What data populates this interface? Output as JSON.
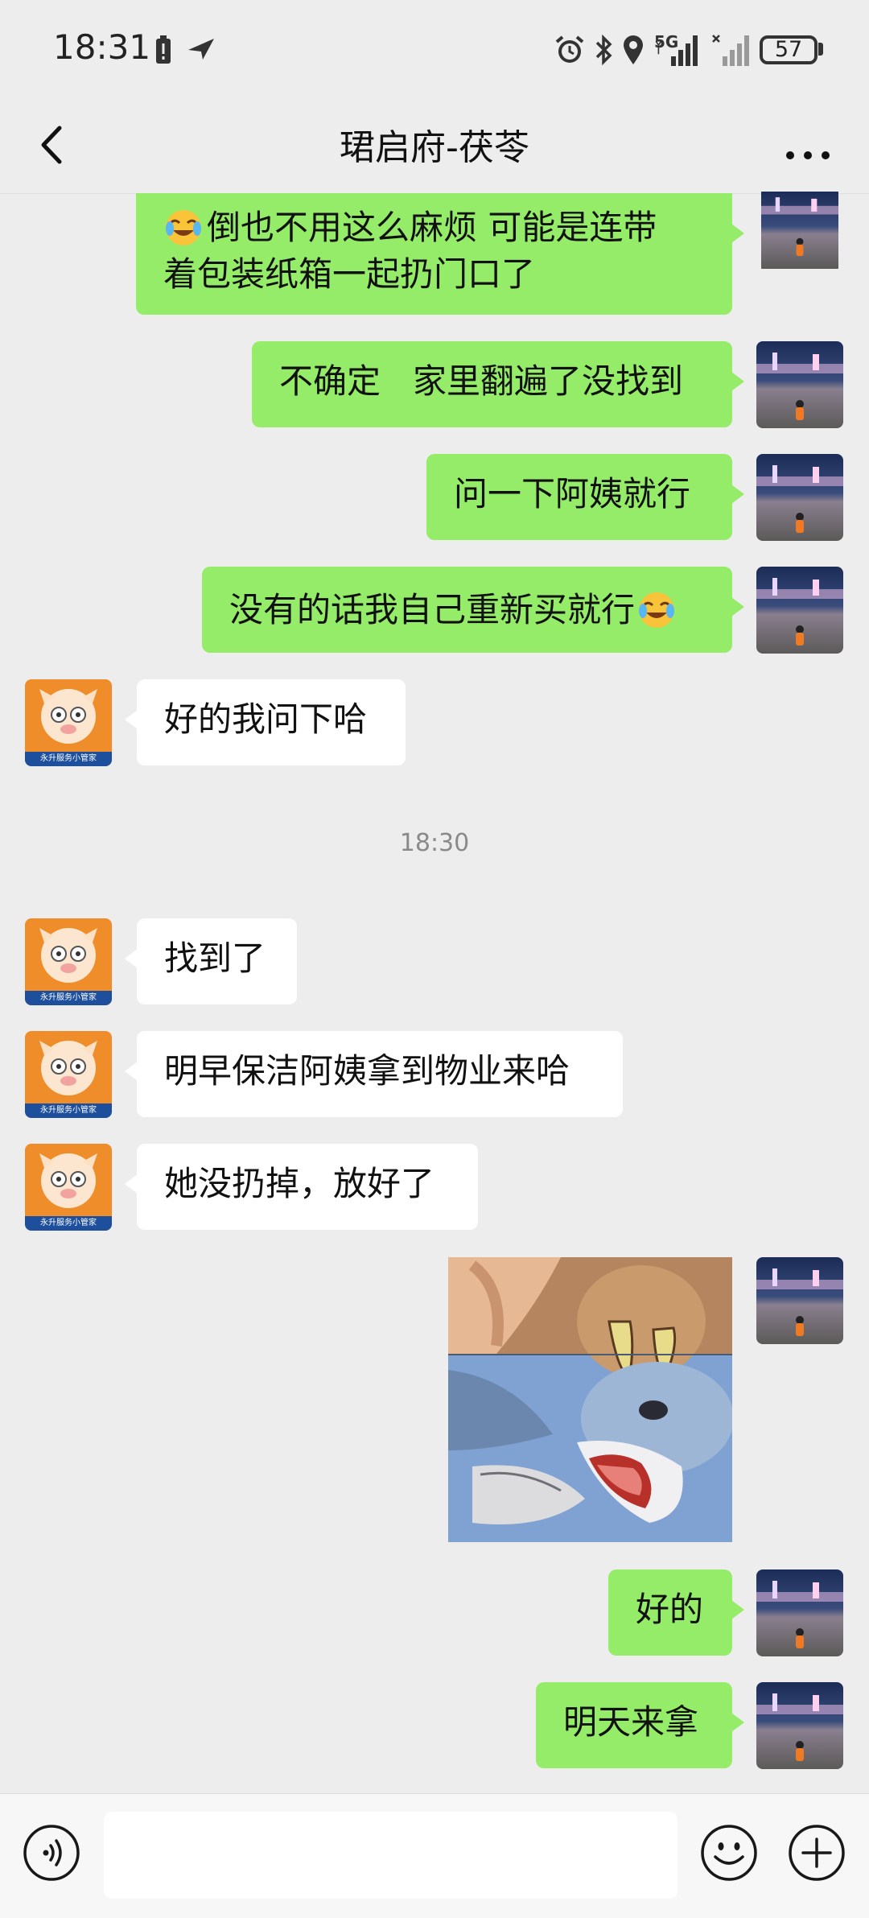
{
  "status_bar": {
    "time": "18:31",
    "network": "5G",
    "battery": "57"
  },
  "header": {
    "title": "珺启府-茯苓",
    "back_icon": "chevron-left-icon",
    "more_icon": "more-horizontal-icon"
  },
  "messages": [
    {
      "side": "right",
      "lines": [
        "倒也不用这么麻烦  可能是连带",
        "着包装纸箱一起扔门口了"
      ],
      "emoji": "face-with-tears-of-joy"
    },
    {
      "side": "right",
      "text": "不确定   家里翻遍了没找到"
    },
    {
      "side": "right",
      "text": "问一下阿姨就行"
    },
    {
      "side": "right",
      "text": "没有的话我自己重新买就行",
      "emoji": "face-with-tears-of-joy"
    },
    {
      "side": "left",
      "text": "好的我问下哈"
    },
    {
      "side": "right",
      "text": "好的"
    },
    {
      "side": "right",
      "text": "明天来拿"
    }
  ],
  "timestamp": "18:30",
  "messages_after": [
    {
      "side": "left",
      "text": "找到了"
    },
    {
      "side": "left",
      "text": "明早保洁阿姨拿到物业来哈"
    },
    {
      "side": "left",
      "text": "她没扔掉，放好了"
    }
  ],
  "avatar_label": "永升服务小管家",
  "bottom_bar": {
    "input_value": "",
    "voice_icon": "voice-icon",
    "emoji_icon": "emoji-smile-icon",
    "plus_icon": "plus-circle-icon"
  },
  "colors": {
    "background": "#ededed",
    "bubble_green": "#95ec69",
    "bubble_white": "#ffffff"
  }
}
